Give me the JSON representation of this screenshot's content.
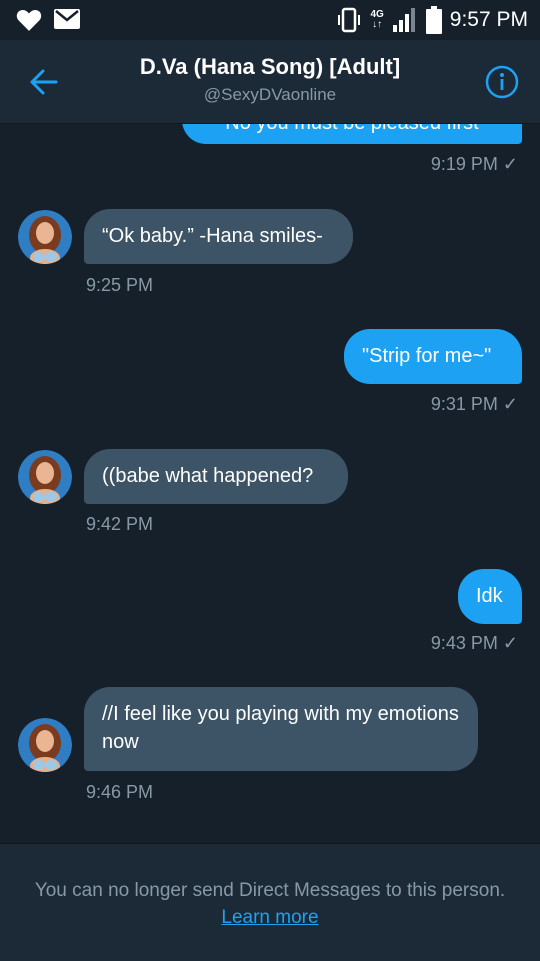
{
  "status_bar": {
    "time": "9:57 PM",
    "network": "4G"
  },
  "header": {
    "title": "D.Va (Hana Song) [Adult]",
    "handle": "@SexyDVaonline"
  },
  "messages": [
    {
      "dir": "out",
      "text": "No you must be pleased first",
      "time": "9:19 PM"
    },
    {
      "dir": "in",
      "text": "“Ok baby.” -Hana smiles-",
      "time": "9:25 PM"
    },
    {
      "dir": "out",
      "text": "\"Strip for me~\"",
      "time": "9:31 PM"
    },
    {
      "dir": "in",
      "text": "((babe what happened?",
      "time": "9:42 PM"
    },
    {
      "dir": "out",
      "text": "Idk",
      "time": "9:43 PM"
    },
    {
      "dir": "in",
      "text": "//I feel like you playing with my emotions now",
      "time": "9:46 PM"
    }
  ],
  "read_check": "✓",
  "footer": {
    "notice": "You can no longer send Direct Messages to this person.",
    "link": "Learn more"
  },
  "colors": {
    "accent": "#1da1f2",
    "background": "#15202b",
    "incoming_bubble": "#3d5466",
    "muted_text": "#8899a6"
  },
  "icons": [
    "heart-icon",
    "mail-icon",
    "vibrate-icon",
    "signal-icon",
    "battery-icon",
    "back-arrow-icon",
    "info-icon"
  ]
}
